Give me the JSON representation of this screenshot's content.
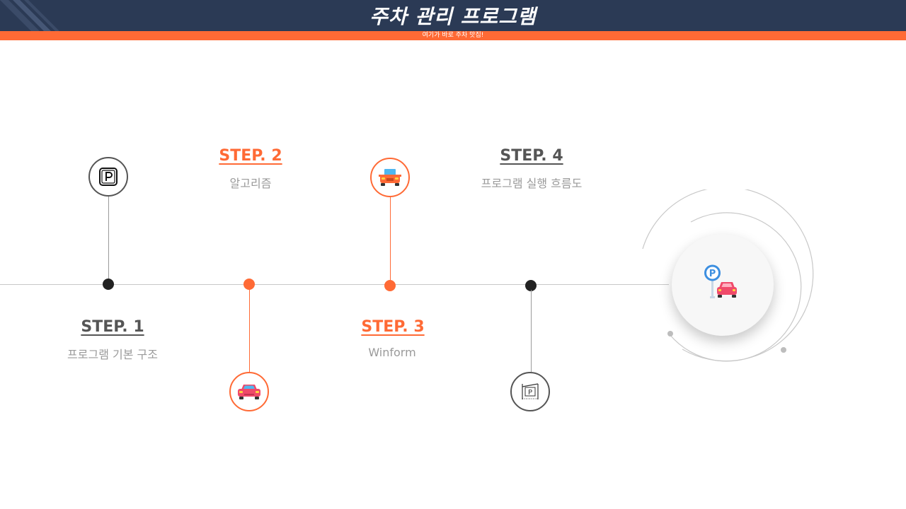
{
  "header": {
    "title": "주차 관리 프로그램",
    "subtitle": "여기가 바로 주차 맛집!"
  },
  "steps": [
    {
      "title": "STEP. 1",
      "subtitle": "프로그램 기본 구조",
      "icon": "parking-sign-icon"
    },
    {
      "title": "STEP. 2",
      "subtitle": "알고리즘",
      "icon": "car-icon"
    },
    {
      "title": "STEP. 3",
      "subtitle": "Winform",
      "icon": "car-front-icon"
    },
    {
      "title": "STEP. 4",
      "subtitle": "프로그램 실행 흐름도",
      "icon": "parking-lot-icon"
    }
  ],
  "colors": {
    "header_bg": "#2b3a55",
    "accent": "#ff6a35",
    "dark": "#222222",
    "gray_text": "#9a9a9a"
  },
  "center_icon": "parking-car-icon"
}
